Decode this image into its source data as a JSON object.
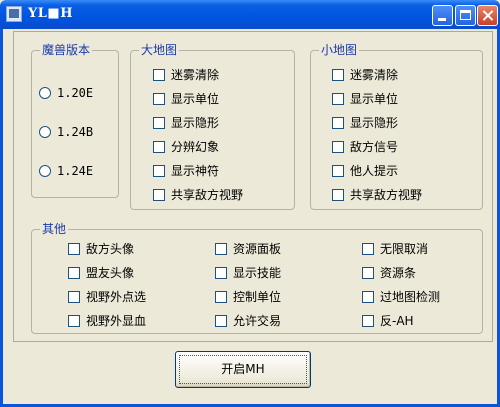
{
  "window": {
    "title": "YL■H"
  },
  "groups": {
    "version": {
      "title": "魔兽版本",
      "options": [
        "1.20E",
        "1.24B",
        "1.24E"
      ]
    },
    "bigmap": {
      "title": "大地图",
      "items": [
        "迷雾清除",
        "显示单位",
        "显示隐形",
        "分辨幻象",
        "显示神符",
        "共享敌方视野"
      ]
    },
    "minimap": {
      "title": "小地图",
      "items": [
        "迷雾清除",
        "显示单位",
        "显示隐形",
        "敌方信号",
        "他人提示",
        "共享敌方视野"
      ]
    },
    "other": {
      "title": "其他",
      "col1": [
        "敌方头像",
        "盟友头像",
        "视野外点选",
        "视野外显血"
      ],
      "col2": [
        "资源面板",
        "显示技能",
        "控制单位",
        "允许交易"
      ],
      "col3": [
        "无限取消",
        "资源条",
        "过地图检测",
        "反-AH"
      ]
    }
  },
  "start_button": {
    "label": "开启MH"
  }
}
